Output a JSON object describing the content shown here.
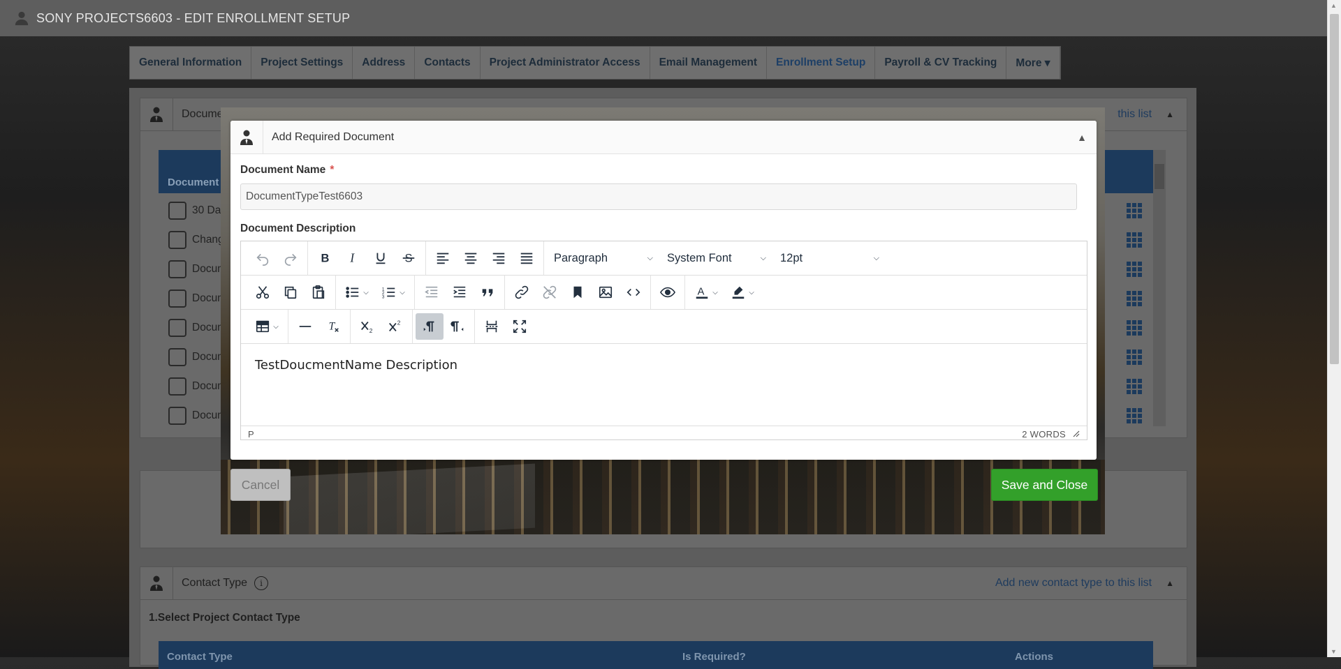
{
  "title_bar": {
    "text": "SONY PROJECTS6603 - EDIT ENROLLMENT SETUP",
    "icon": "user-icon"
  },
  "tabs": [
    "General Information",
    "Project Settings",
    "Address",
    "Contacts",
    "Project Administrator Access",
    "Email Management",
    "Enrollment Setup",
    "Payroll & CV Tracking",
    "More ▾"
  ],
  "active_tab": "Enrollment Setup",
  "documents_panel": {
    "title": "Docume",
    "add_link": "this list",
    "grid_header": "Document",
    "rows": [
      "30 Da",
      "Chang",
      "Docum",
      "Docum",
      "Docum",
      "Docum",
      "Docum",
      "Docum"
    ]
  },
  "contact_panel": {
    "title": "Contact Type",
    "add_link": "Add new contact type to this list",
    "subtitle": "1.Select Project Contact Type",
    "columns": [
      "Contact Type",
      "Is Required?",
      "Actions"
    ]
  },
  "modal": {
    "title": "Add Required Document",
    "doc_name_label": "Document Name",
    "required_mark": "*",
    "doc_name_value": "DocumentTypeTest6603",
    "doc_desc_label": "Document Description",
    "editor": {
      "block_format": "Paragraph",
      "font_family": "System Font",
      "font_size": "12pt",
      "content": "TestDoucmentName Description",
      "path": "P",
      "word_count": "2 WORDS"
    },
    "cancel_label": "Cancel",
    "save_label": "Save and Close"
  },
  "colors": {
    "save": "#33a02a",
    "header_blue": "#1c3a5c",
    "accent_link": "#1e3b5e"
  }
}
